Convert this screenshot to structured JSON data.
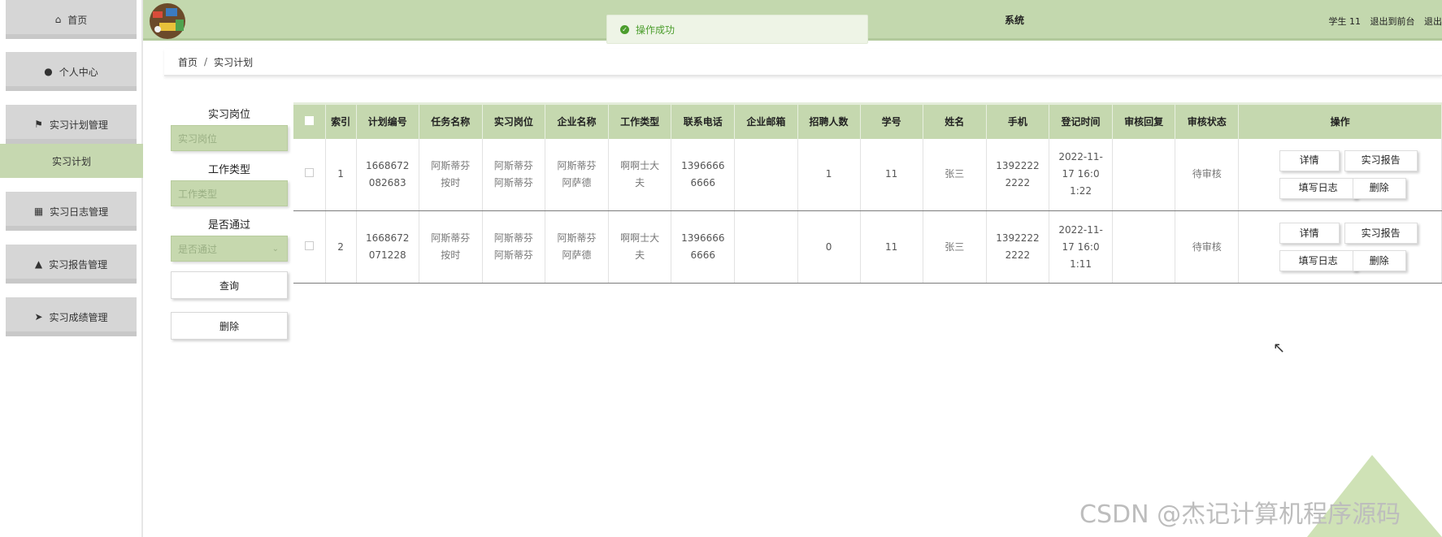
{
  "sidebar": {
    "items": [
      {
        "icon": "home-icon",
        "label": "首页"
      },
      {
        "icon": "user-icon",
        "label": "个人中心"
      },
      {
        "icon": "flag-icon",
        "label": "实习计划管理"
      },
      {
        "label": "实习计划"
      },
      {
        "icon": "grid-icon",
        "label": "实习日志管理"
      },
      {
        "icon": "person-icon",
        "label": "实习报告管理"
      },
      {
        "icon": "send-icon",
        "label": "实习成绩管理"
      }
    ]
  },
  "header": {
    "title": "系统",
    "user": "学生 11",
    "to_front": "退出到前台",
    "logout": "退出"
  },
  "toast": {
    "message": "操作成功"
  },
  "breadcrumb": {
    "home": "首页",
    "current": "实习计划"
  },
  "filter": {
    "post_label": "实习岗位",
    "post_placeholder": "实习岗位",
    "worktype_label": "工作类型",
    "worktype_placeholder": "工作类型",
    "passed_label": "是否通过",
    "passed_placeholder": "是否通过",
    "search_button": "查询",
    "delete_button": "删除"
  },
  "table": {
    "headers": [
      "索引",
      "计划编号",
      "任务名称",
      "实习岗位",
      "企业名称",
      "工作类型",
      "联系电话",
      "企业邮箱",
      "招聘人数",
      "学号",
      "姓名",
      "手机",
      "登记时间",
      "审核回复",
      "审核状态",
      "操作"
    ],
    "rows": [
      {
        "index": "1",
        "plan_no": "1668672082683",
        "task": "阿斯蒂芬按时",
        "post": "阿斯蒂芬阿斯蒂芬",
        "company": "阿斯蒂芬阿萨德",
        "work_type": "啊啊士大夫",
        "phone": "13966666666",
        "email": "",
        "hire_count": "1",
        "student_no": "11",
        "name": "张三",
        "mobile": "13922222222",
        "reg_time": "2022-11-17 16:01:22",
        "reply": "",
        "status": "待审核"
      },
      {
        "index": "2",
        "plan_no": "1668672071228",
        "task": "阿斯蒂芬按时",
        "post": "阿斯蒂芬阿斯蒂芬",
        "company": "阿斯蒂芬阿萨德",
        "work_type": "啊啊士大夫",
        "phone": "13966666666",
        "email": "",
        "hire_count": "0",
        "student_no": "11",
        "name": "张三",
        "mobile": "13922222222",
        "reg_time": "2022-11-17 16:01:11",
        "reply": "",
        "status": "待审核"
      }
    ],
    "actions": {
      "detail": "详情",
      "report": "实习报告",
      "log": "填写日志",
      "delete": "删除"
    }
  },
  "watermark": "CSDN @杰记计算机程序源码",
  "colors": {
    "accent": "#c3d8ae",
    "success": "#4b9d2c"
  }
}
